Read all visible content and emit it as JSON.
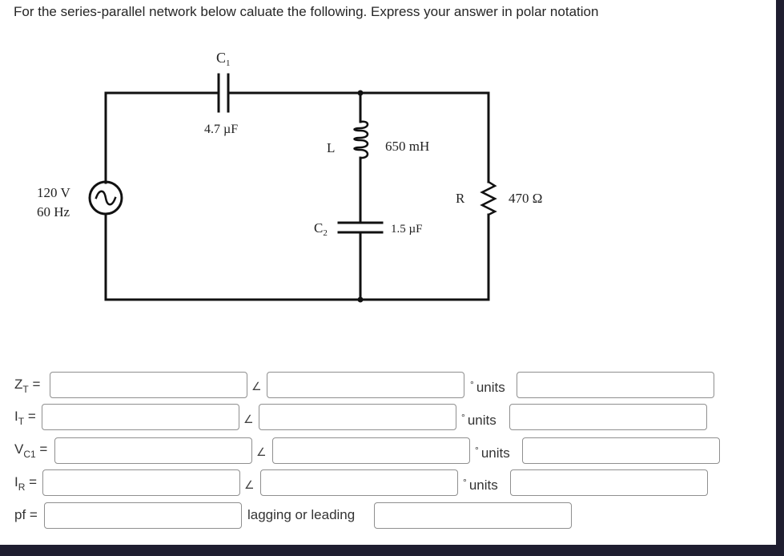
{
  "question": {
    "text": "For the series-parallel network below caluate the following. Express your answer in polar notation"
  },
  "circuit": {
    "source": {
      "voltage": "120 V",
      "frequency": "60 Hz"
    },
    "c1": {
      "name": "C",
      "sub": "1",
      "value": "4.7 µF"
    },
    "l": {
      "name": "L",
      "value": "650 mH"
    },
    "c2": {
      "name": "C",
      "sub": "2",
      "value": "1.5 µF"
    },
    "r": {
      "name": "R",
      "value": "470 Ω"
    }
  },
  "answers": {
    "angle_symbol": "∠",
    "degree_symbol": "°",
    "units_label": "units",
    "rows": [
      {
        "label": "Z",
        "sub": "T",
        "eq": "=",
        "magnitude": "",
        "angle": "",
        "units": ""
      },
      {
        "label": "I",
        "sub": "T",
        "eq": "=",
        "magnitude": "",
        "angle": "",
        "units": ""
      },
      {
        "label": "V",
        "sub": "C1",
        "eq": "=",
        "magnitude": "",
        "angle": "",
        "units": ""
      },
      {
        "label": "I",
        "sub": "R",
        "eq": "=",
        "magnitude": "",
        "angle": "",
        "units": ""
      }
    ],
    "pf": {
      "label": "pf =",
      "value": "",
      "lag_lead_label": "lagging or leading",
      "lag_lead_value": ""
    }
  }
}
